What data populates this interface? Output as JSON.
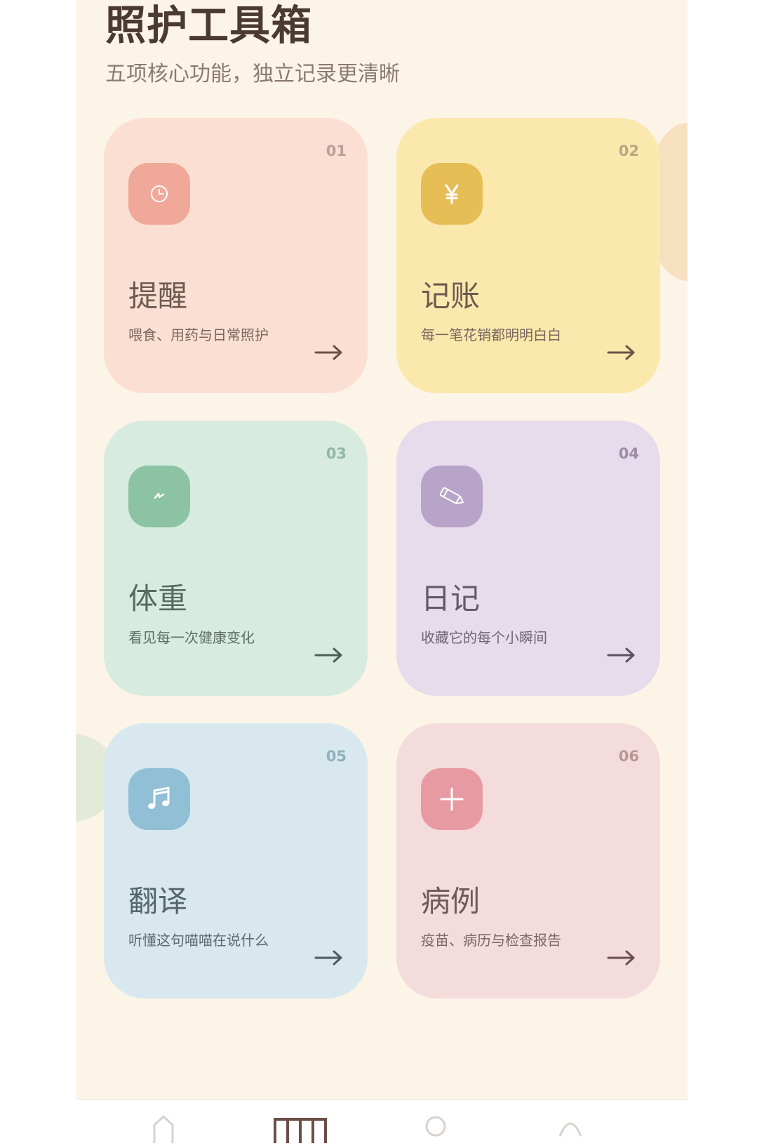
{
  "header": {
    "title": "照护工具箱",
    "subtitle": "五项核心功能，独立记录更清晰"
  },
  "cards": [
    {
      "number": "01",
      "name": "提醒",
      "desc": "喂食、用药与日常照护",
      "icon": "clock-icon"
    },
    {
      "number": "02",
      "name": "记账",
      "desc": "每一笔花销都明明白白",
      "icon": "yen-icon"
    },
    {
      "number": "03",
      "name": "体重",
      "desc": "看见每一次健康变化",
      "icon": "pulse-icon"
    },
    {
      "number": "04",
      "name": "日记",
      "desc": "收藏它的每个小瞬间",
      "icon": "pencil-icon"
    },
    {
      "number": "05",
      "name": "翻译",
      "desc": "听懂这句喵喵在说什么",
      "icon": "music-note-icon"
    },
    {
      "number": "06",
      "name": "病例",
      "desc": "疫苗、病历与检查报告",
      "icon": "plus-icon"
    }
  ],
  "colors": {
    "background": "#fcf4e7",
    "reminder": "#fbdfd2",
    "accounting": "#fbe8ad",
    "weight": "#d8ebe0",
    "diary": "#e7dcec",
    "translate": "#d8e8ee",
    "medical": "#f4dcdc"
  },
  "bottom_nav": {
    "active_tab": "tab-toolbox"
  }
}
